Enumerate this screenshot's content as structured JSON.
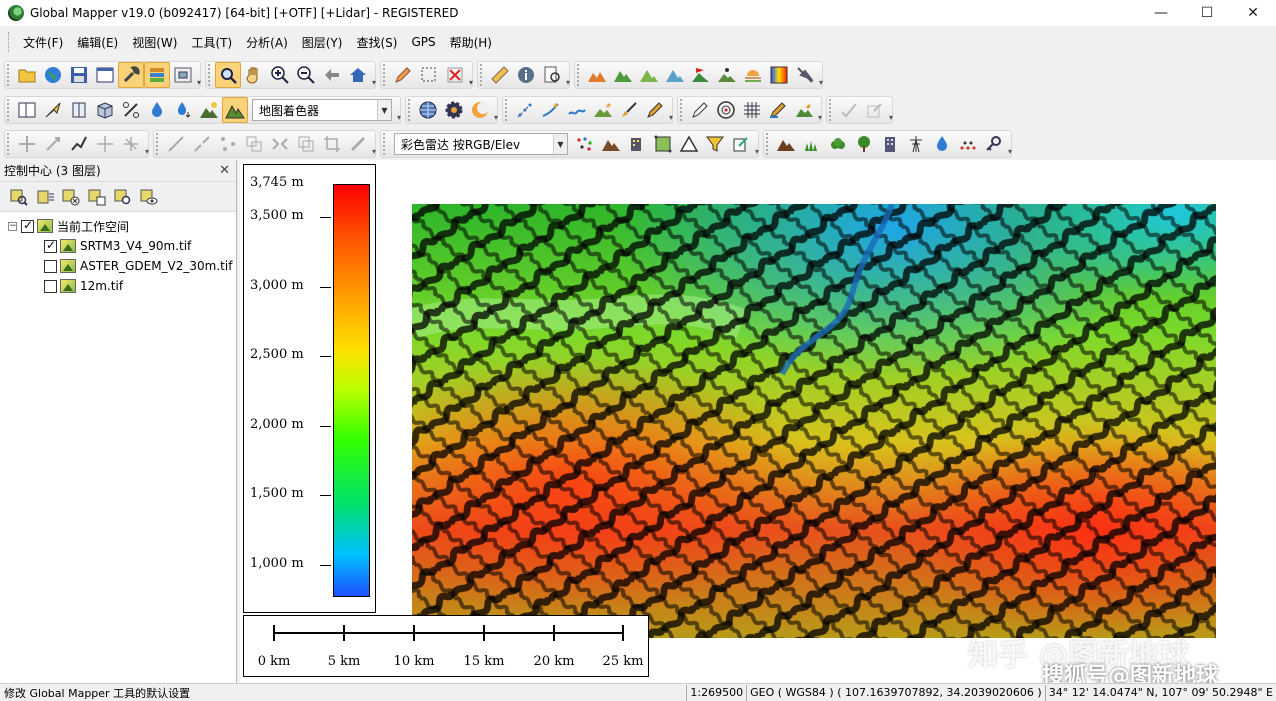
{
  "window": {
    "title": "Global Mapper v19.0 (b092417) [64-bit] [+OTF] [+Lidar] - REGISTERED",
    "minimize": "—",
    "maximize": "☐",
    "close": "✕"
  },
  "menu": [
    {
      "label": "文件(F)"
    },
    {
      "label": "编辑(E)"
    },
    {
      "label": "视图(W)"
    },
    {
      "label": "工具(T)"
    },
    {
      "label": "分析(A)"
    },
    {
      "label": "图层(Y)"
    },
    {
      "label": "查找(S)"
    },
    {
      "label": "GPS"
    },
    {
      "label": "帮助(H)"
    }
  ],
  "toolbar": {
    "shader_select": "地图着色器",
    "lidar_color_select": "彩色雷达 按RGB/Elev"
  },
  "control_center": {
    "title": "控制中心 (3 图层)",
    "close": "✕",
    "workspace_label": "当前工作空间",
    "expander": "−",
    "layers": [
      {
        "name": "SRTM3_V4_90m.tif",
        "checked": true
      },
      {
        "name": "ASTER_GDEM_V2_30m.tif",
        "checked": false
      },
      {
        "name": "12m.tif",
        "checked": false
      }
    ]
  },
  "legend": {
    "max_label": "3,745 m",
    "labels": [
      "3,500 m",
      "3,000 m",
      "2,500 m",
      "2,000 m",
      "1,500 m",
      "1,000 m"
    ],
    "colors": {
      "high": "#ff0000",
      "mid": "#ffe000",
      "low": "#1e50ff"
    }
  },
  "scalebar": {
    "labels": [
      "0 km",
      "5 km",
      "10 km",
      "15 km",
      "20 km",
      "25 km"
    ]
  },
  "watermark": {
    "line1": "知乎 @图新地球",
    "line2": "搜狐号@图新地球"
  },
  "status": {
    "message": "修改 Global Mapper 工具的默认设置",
    "scale": "1:269500",
    "projection": "GEO ( WGS84 ) ( 107.1639707892, 34.2039020606 )",
    "dms": "34° 12' 14.0474\" N, 107° 09' 50.2948\" E"
  }
}
